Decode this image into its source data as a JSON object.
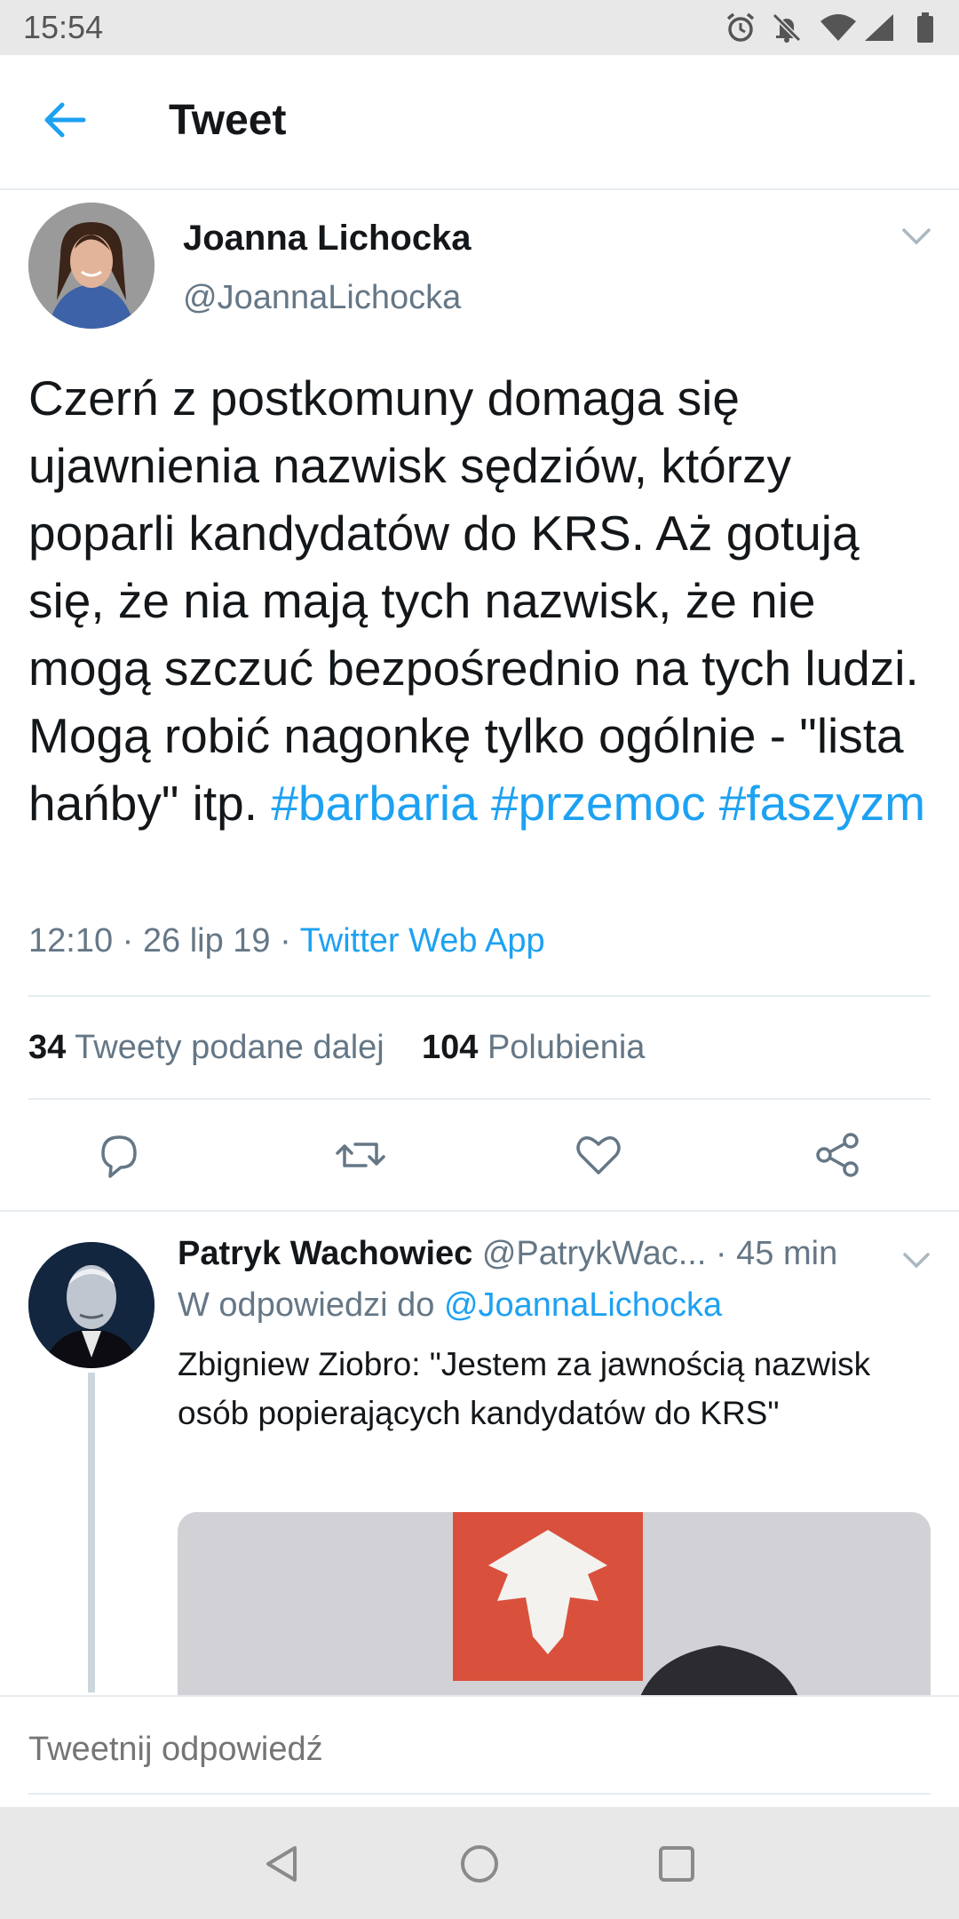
{
  "status_bar": {
    "time": "15:54"
  },
  "header": {
    "title": "Tweet"
  },
  "tweet": {
    "author_name": "Joanna Lichocka",
    "author_handle": "@JoannaLichocka",
    "text": "Czerń z postkomuny domaga się ujawnienia nazwisk sędziów, którzy poparli kandydatów do KRS. Aż gotują się, że nia mają tych nazwisk, że nie mogą szczuć bezpośrednio na tych ludzi. Mogą robić nagonkę tylko ogólnie - \"lista hańby\" itp.",
    "hashtags": [
      "#barbaria",
      "#przemoc",
      "#faszyzm"
    ],
    "time": "12:10",
    "date": "26 lip 19",
    "source": "Twitter Web App",
    "retweets_count": "34",
    "retweets_label": "Tweety podane dalej",
    "likes_count": "104",
    "likes_label": "Polubienia"
  },
  "reply": {
    "author_name": "Patryk Wachowiec",
    "author_handle": "@PatrykWac...",
    "age": "45 min",
    "in_reply_prefix": "W odpowiedzi do",
    "in_reply_mention": "@JoannaLichocka",
    "text": "Zbigniew Ziobro: \"Jestem za jawnością nazwisk osób popierających kandydatów do KRS\""
  },
  "composer": {
    "placeholder": "Tweetnij odpowiedź"
  },
  "colors": {
    "accent": "#1da1f2",
    "text": "#14171a",
    "secondary": "#657786",
    "divider": "#e6ecf0"
  },
  "icons": [
    "back-arrow-icon",
    "chevron-down-icon",
    "reply-icon",
    "retweet-icon",
    "like-icon",
    "share-icon",
    "alarm-icon",
    "mute-icon",
    "wifi-icon",
    "signal-icon",
    "battery-icon",
    "nav-back-icon",
    "nav-home-icon",
    "nav-recents-icon"
  ]
}
